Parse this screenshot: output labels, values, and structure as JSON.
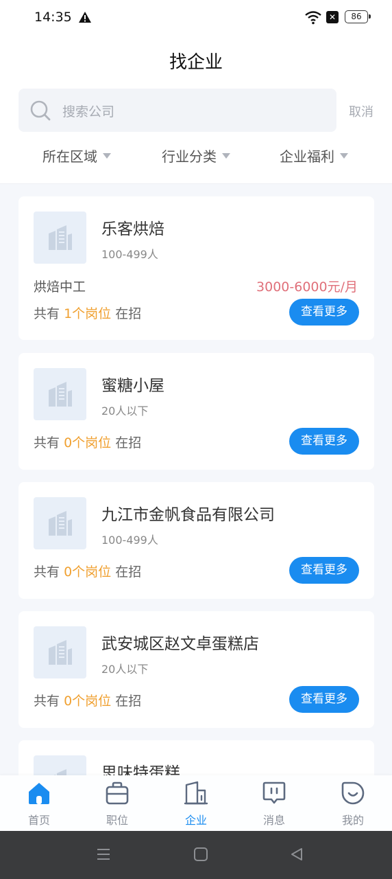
{
  "status": {
    "time": "14:35",
    "battery": "86",
    "sim": "✕"
  },
  "header": {
    "title": "找企业",
    "search_placeholder": "搜索公司",
    "cancel": "取消",
    "filters": [
      "所在区域",
      "行业分类",
      "企业福利"
    ]
  },
  "companies": [
    {
      "name": "乐客烘焙",
      "size": "100-499人",
      "job": "烘焙中工",
      "salary": "3000-6000元/月",
      "prefix": "共有",
      "count": "1个岗位",
      "suffix": "在招",
      "button": "查看更多"
    },
    {
      "name": "蜜糖小屋",
      "size": "20人以下",
      "prefix": "共有",
      "count": "0个岗位",
      "suffix": "在招",
      "button": "查看更多"
    },
    {
      "name": "九江市金帆食品有限公司",
      "size": "100-499人",
      "prefix": "共有",
      "count": "0个岗位",
      "suffix": "在招",
      "button": "查看更多"
    },
    {
      "name": "武安城区赵文卓蛋糕店",
      "size": "20人以下",
      "prefix": "共有",
      "count": "0个岗位",
      "suffix": "在招",
      "button": "查看更多"
    },
    {
      "name": "思味特蛋糕"
    }
  ],
  "tabs": [
    {
      "label": "首页",
      "icon": "home-icon"
    },
    {
      "label": "职位",
      "icon": "briefcase-icon"
    },
    {
      "label": "企业",
      "icon": "building-icon",
      "active": true
    },
    {
      "label": "消息",
      "icon": "message-icon"
    },
    {
      "label": "我的",
      "icon": "profile-icon"
    }
  ],
  "colors": {
    "accent": "#1a8cf0",
    "salary": "#e0707a",
    "highlight": "#f0a030"
  }
}
